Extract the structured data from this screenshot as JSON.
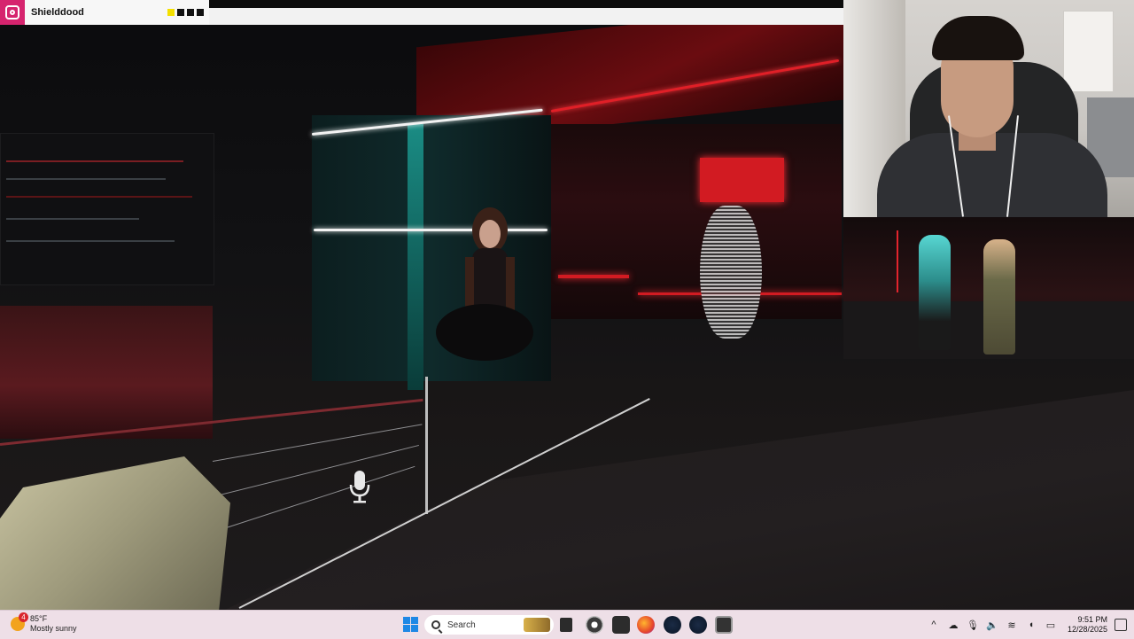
{
  "overlay": {
    "streamer_handle": "Shielddood",
    "square_colors": [
      "#f4e000",
      "#111111",
      "#111111",
      "#111111"
    ]
  },
  "scene": {
    "accent_red": "#d21b22",
    "accent_teal": "#1a8c84"
  },
  "taskbar": {
    "weather_badge": "4",
    "weather_temp": "85°F",
    "weather_condition": "Mostly sunny",
    "search_placeholder": "Search",
    "apps": [
      "task-view",
      "chrome",
      "epic-games",
      "firefox",
      "steam",
      "steam-alt",
      "vrchat"
    ],
    "tray_chevron": "^",
    "time": "9:51 PM",
    "date": "12/28/2025"
  }
}
